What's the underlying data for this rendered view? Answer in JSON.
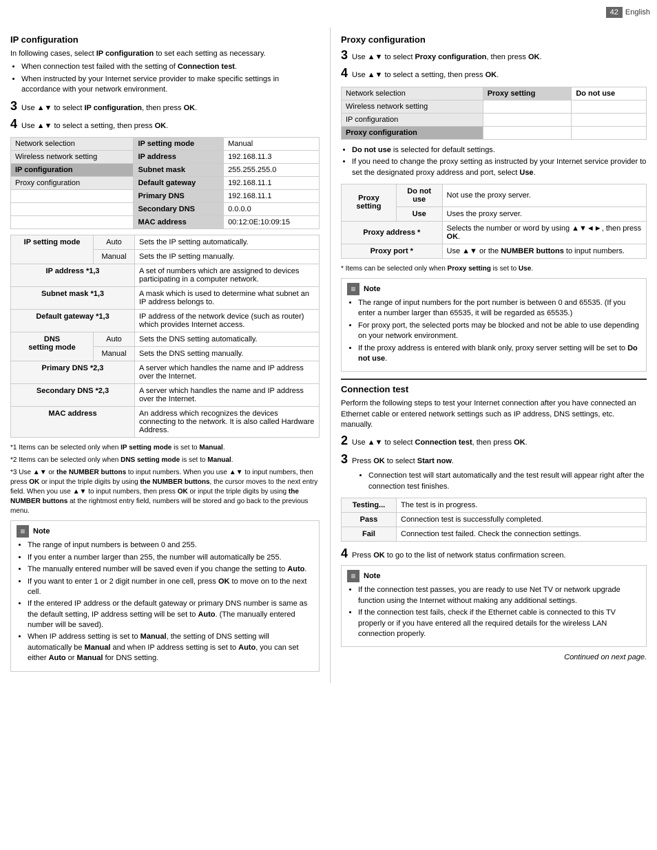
{
  "page": {
    "number": "42",
    "language": "English"
  },
  "left": {
    "ip_config_title": "IP configuration",
    "ip_config_intro": "In following cases, select IP configuration to set each setting as necessary.",
    "bullet1": "When connection test failed with the setting of Connection test.",
    "bullet2": "When instructed by your Internet service provider to make specific settings in accordance with your network environment.",
    "step3_num": "3",
    "step3_text": "Use ▲▼ to select IP configuration, then press OK.",
    "step4_num": "4",
    "step4_text": "Use ▲▼ to select a setting, then press OK.",
    "menu": {
      "col1_rows": [
        "Network selection",
        "Wireless network setting",
        "IP configuration",
        "Proxy configuration"
      ],
      "col2_header": "IP setting mode",
      "col2_rows": [
        "IP address",
        "Subnet mask",
        "Default gateway",
        "Primary DNS",
        "Secondary DNS",
        "MAC address"
      ],
      "col3_rows": [
        "Manual",
        "192.168.11.3",
        "255.255.255.0",
        "192.168.11.1",
        "192.168.11.1",
        "0.0.0.0",
        "00:12:0E:10:09:15"
      ]
    },
    "desc_table": {
      "rows": [
        {
          "label": "IP setting mode",
          "sub1": "Auto",
          "desc1": "Sets the IP setting automatically.",
          "sub2": "Manual",
          "desc2": "Sets the IP setting manually."
        },
        {
          "label": "IP address *1,3",
          "desc": "A set of numbers which are assigned to devices participating in a computer network."
        },
        {
          "label": "Subnet mask *1,3",
          "desc": "A mask which is used to determine what subnet an IP address belongs to."
        },
        {
          "label": "Default gateway *1,3",
          "desc": "IP address of the network device (such as router) which provides Internet access."
        },
        {
          "label": "DNS setting mode",
          "sub1": "Auto",
          "desc1": "Sets the DNS setting automatically.",
          "sub2": "Manual",
          "desc2": "Sets the DNS setting manually."
        },
        {
          "label": "Primary DNS *2,3",
          "desc": "A server which handles the name and IP address over the Internet."
        },
        {
          "label": "Secondary DNS *2,3",
          "desc": "A server which handles the name and IP address over the Internet."
        },
        {
          "label": "MAC address",
          "desc": "An address which recognizes the devices connecting to the network. It is also called Hardware Address."
        }
      ]
    },
    "footnotes": [
      "*1 Items can be selected only when IP setting mode is set to Manual.",
      "*2 Items can be selected only when DNS setting mode is set to Manual.",
      "*3 Use ▲▼ or the NUMBER buttons to input numbers. When you use ▲▼ to input numbers, then press OK or input the triple digits by using the NUMBER buttons, the cursor moves to the next entry field. When you use ▲▼ to input numbers, then press OK or input the triple digits by using the NUMBER buttons at the rightmost entry field, numbers will be stored and go back to the previous menu."
    ],
    "note_title": "Note",
    "note_bullets": [
      "The range of input numbers is between 0 and 255.",
      "If you enter a number larger than 255, the number will automatically be 255.",
      "The manually entered number will be saved even if you change the setting to Auto.",
      "If you want to enter 1 or 2 digit number in one cell, press OK to move on to the next cell.",
      "If the entered IP address or the default gateway or primary DNS number is same as the default setting, IP address setting will be set to Auto. (The manually entered number will be saved).",
      "When IP address setting is set to Manual, the setting of DNS setting will automatically be Manual and when IP address setting is set to Auto, you can set either Auto or Manual for DNS setting."
    ]
  },
  "right": {
    "proxy_config_title": "Proxy configuration",
    "step3_num": "3",
    "step3_text": "Use ▲▼ to select Proxy configuration, then press OK.",
    "step4_num": "4",
    "step4_text": "Use ▲▼ to select a setting, then press OK.",
    "proxy_menu": {
      "col1": "Network selection",
      "col2": "Proxy setting",
      "col3": "Do not use",
      "rows": [
        "Wireless network setting",
        "IP configuration",
        "Proxy configuration"
      ]
    },
    "proxy_bullets": [
      "Do not use is selected for default settings.",
      "If you need to change the proxy setting as instructed by your Internet service provider to set the designated proxy address and port, select Use."
    ],
    "proxy_setting_table": {
      "rows": [
        {
          "main": "Proxy setting",
          "sub": "Do not use",
          "desc": "Not use the proxy server."
        },
        {
          "main": "",
          "sub": "Use",
          "desc": "Uses the proxy server."
        },
        {
          "main": "Proxy address *",
          "sub": "",
          "desc": "Selects the number or word by using ▲▼◄►, then press OK."
        },
        {
          "main": "Proxy port *",
          "sub": "",
          "desc": "Use ▲▼ or the NUMBER buttons to input numbers."
        }
      ]
    },
    "proxy_footnote": "* Items can be selected only when Proxy setting is set to Use.",
    "proxy_note_title": "Note",
    "proxy_note_bullets": [
      "The range of input numbers for the port number is between 0 and 65535. (If you enter a number larger than 65535, it will be regarded as 65535.)",
      "For proxy port, the selected ports may be blocked and not be able to use depending on your network environment.",
      "If the proxy address is entered with blank only, proxy server setting will be set to Do not use."
    ],
    "conn_test_title": "Connection test",
    "conn_test_intro": "Perform the following steps to test your Internet connection after you have connected an Ethernet cable or entered network settings such as IP address, DNS settings, etc. manually.",
    "step2_num": "2",
    "step2_text": "Use ▲▼ to select Connection test, then press OK.",
    "step3b_num": "3",
    "step3b_text": "Press OK to select Start now.",
    "step3b_bullet": "Connection test will start automatically and the test result will appear right after the connection test finishes.",
    "conn_table": {
      "rows": [
        {
          "label": "Testing...",
          "desc": "The test is in progress."
        },
        {
          "label": "Pass",
          "desc": "Connection test is successfully completed."
        },
        {
          "label": "Fail",
          "desc": "Connection test failed. Check the connection settings."
        }
      ]
    },
    "step4_num2": "4",
    "step4_text2": "Press OK to go to the list of network status confirmation screen.",
    "conn_note_title": "Note",
    "conn_note_bullets": [
      "If the connection test passes, you are ready to use Net TV or network upgrade function using the Internet without making any additional settings.",
      "If the connection test fails, check if the Ethernet cable is connected to this TV properly or if you have entered all the required details for the wireless LAN connection properly."
    ],
    "continued": "Continued on next page."
  }
}
